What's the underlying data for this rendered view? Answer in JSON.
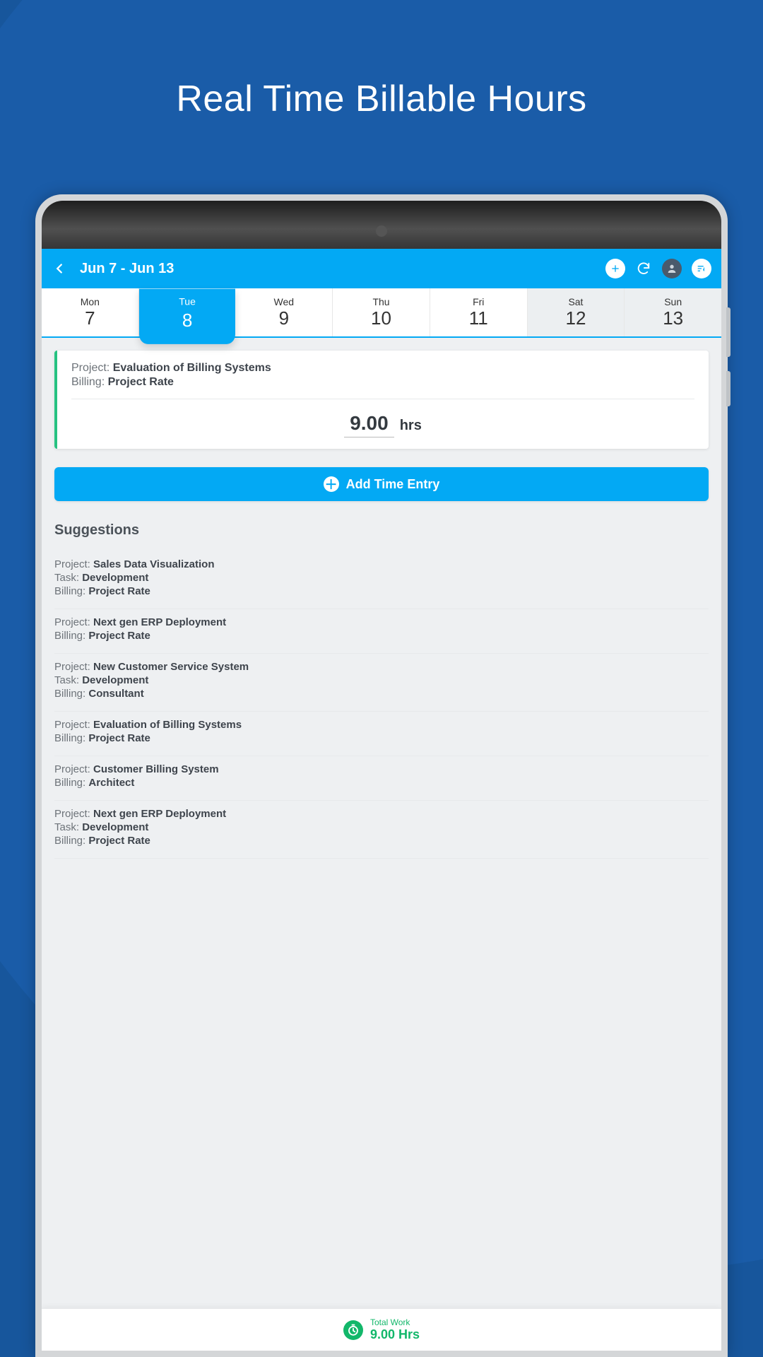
{
  "hero": {
    "title": "Real Time Billable Hours"
  },
  "appbar": {
    "date_range": "Jun 7 - Jun 13"
  },
  "days": [
    {
      "dow": "Mon",
      "num": "7",
      "active": false,
      "weekend": false
    },
    {
      "dow": "Tue",
      "num": "8",
      "active": true,
      "weekend": false
    },
    {
      "dow": "Wed",
      "num": "9",
      "active": false,
      "weekend": false
    },
    {
      "dow": "Thu",
      "num": "10",
      "active": false,
      "weekend": false
    },
    {
      "dow": "Fri",
      "num": "11",
      "active": false,
      "weekend": false
    },
    {
      "dow": "Sat",
      "num": "12",
      "active": false,
      "weekend": true
    },
    {
      "dow": "Sun",
      "num": "13",
      "active": false,
      "weekend": true
    }
  ],
  "entry": {
    "project_label": "Project: ",
    "project_value": "Evaluation of Billing Systems",
    "billing_label": "Billing: ",
    "billing_value": "Project Rate",
    "hours": "9.00",
    "hours_unit": "hrs"
  },
  "add_button": "Add Time Entry",
  "suggestions_title": "Suggestions",
  "labels": {
    "project": "Project: ",
    "task": "Task: ",
    "billing": "Billing: "
  },
  "suggestions": [
    {
      "project": "Sales Data Visualization",
      "task": "Development",
      "billing": "Project Rate"
    },
    {
      "project": "Next gen ERP Deployment",
      "task": null,
      "billing": "Project Rate"
    },
    {
      "project": "New Customer Service System",
      "task": "Development",
      "billing": "Consultant"
    },
    {
      "project": "Evaluation of Billing Systems",
      "task": null,
      "billing": "Project Rate"
    },
    {
      "project": "Customer Billing System",
      "task": null,
      "billing": "Architect"
    },
    {
      "project": "Next gen ERP Deployment",
      "task": "Development",
      "billing": "Project Rate"
    }
  ],
  "footer": {
    "label": "Total Work",
    "value": "9.00 Hrs"
  }
}
